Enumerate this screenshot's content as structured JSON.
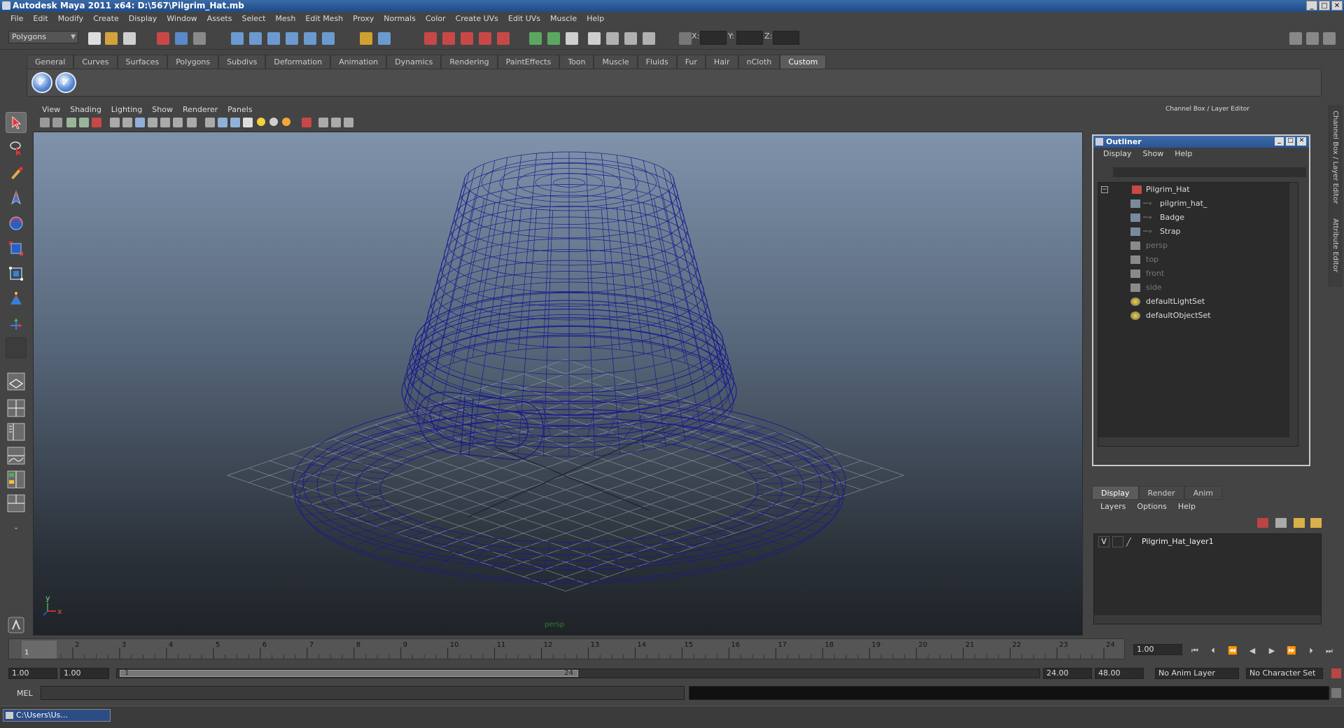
{
  "window": {
    "title": "Autodesk Maya 2011 x64: D:\\567\\Pilgrim_Hat.mb"
  },
  "menubar": [
    "File",
    "Edit",
    "Modify",
    "Create",
    "Display",
    "Window",
    "Assets",
    "Select",
    "Mesh",
    "Edit Mesh",
    "Proxy",
    "Normals",
    "Color",
    "Create UVs",
    "Edit UVs",
    "Muscle",
    "Help"
  ],
  "statusline": {
    "mode": "Polygons",
    "x_label": "X:",
    "y_label": "Y:",
    "z_label": "Z:"
  },
  "shelf": {
    "tabs": [
      "General",
      "Curves",
      "Surfaces",
      "Polygons",
      "Subdivs",
      "Deformation",
      "Animation",
      "Dynamics",
      "Rendering",
      "PaintEffects",
      "Toon",
      "Muscle",
      "Fluids",
      "Fur",
      "Hair",
      "nCloth",
      "Custom"
    ],
    "active_tab": "Custom",
    "buttons": [
      "check-icon",
      "check-icon"
    ]
  },
  "viewport": {
    "menu": [
      "View",
      "Shading",
      "Lighting",
      "Show",
      "Renderer",
      "Panels"
    ],
    "camera_label": "persp",
    "axis_y": "y",
    "axis_x": "x",
    "wire_color": "#1a1a8c"
  },
  "channel_box": {
    "title": "Channel Box / Layer Editor"
  },
  "outliner": {
    "title": "Outliner",
    "menu": [
      "Display",
      "Show",
      "Help"
    ],
    "items": [
      {
        "label": "Pilgrim_Hat",
        "indent": 0,
        "dim": false,
        "icon": "transform-icon"
      },
      {
        "label": "pilgrim_hat_",
        "indent": 1,
        "dim": false,
        "icon": "mesh-icon"
      },
      {
        "label": "Badge",
        "indent": 1,
        "dim": false,
        "icon": "mesh-icon"
      },
      {
        "label": "Strap",
        "indent": 1,
        "dim": false,
        "icon": "mesh-icon"
      },
      {
        "label": "persp",
        "indent": 0,
        "dim": true,
        "icon": "camera-icon"
      },
      {
        "label": "top",
        "indent": 0,
        "dim": true,
        "icon": "camera-icon"
      },
      {
        "label": "front",
        "indent": 0,
        "dim": true,
        "icon": "camera-icon"
      },
      {
        "label": "side",
        "indent": 0,
        "dim": true,
        "icon": "camera-icon"
      },
      {
        "label": "defaultLightSet",
        "indent": 0,
        "dim": false,
        "icon": "set-icon"
      },
      {
        "label": "defaultObjectSet",
        "indent": 0,
        "dim": false,
        "icon": "set-icon"
      }
    ]
  },
  "layer_editor": {
    "tabs": [
      "Display",
      "Render",
      "Anim"
    ],
    "active_tab": "Display",
    "menu": [
      "Layers",
      "Options",
      "Help"
    ],
    "layers": [
      {
        "visible": "V",
        "name": "Pilgrim_Hat_layer1"
      }
    ]
  },
  "side_tabs": [
    "Channel Box / Layer Editor",
    "Attribute Editor"
  ],
  "timeline": {
    "ticks": [
      "1",
      "2",
      "3",
      "4",
      "5",
      "6",
      "7",
      "8",
      "9",
      "10",
      "11",
      "12",
      "13",
      "14",
      "15",
      "16",
      "17",
      "18",
      "19",
      "20",
      "21",
      "22",
      "23",
      "24"
    ],
    "current_marker": "1",
    "current_frame": "1.00"
  },
  "range": {
    "start": "1.00",
    "start2": "1.00",
    "range_start": "1",
    "range_end": "24",
    "end": "24.00",
    "end2": "48.00",
    "anim_layer": "No Anim Layer",
    "character_set": "No Character Set"
  },
  "command_line": {
    "label": "MEL"
  },
  "taskbar": {
    "item": "C:\\Users\\Us..."
  }
}
